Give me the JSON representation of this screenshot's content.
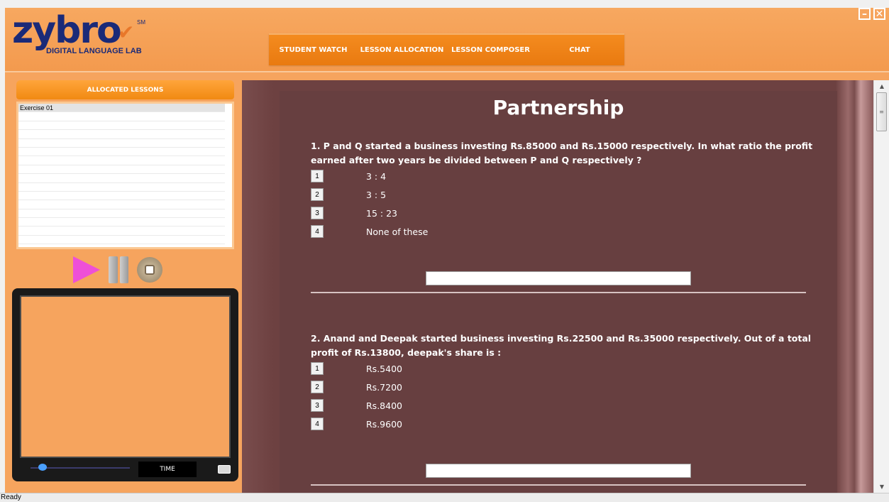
{
  "logo": {
    "wordmark": "zybro",
    "subtitle": "DIGITAL LANGUAGE LAB",
    "mark": "SM"
  },
  "window_controls": {
    "minimize": "–",
    "close": "✕"
  },
  "topnav": [
    "STUDENT WATCH",
    "LESSON ALLOCATION",
    "LESSON COMPOSER",
    "CHAT"
  ],
  "sidebar": {
    "header": "ALLOCATED LESSONS",
    "lessons": [
      "Exercise 01"
    ]
  },
  "player": {
    "time_label": "TIME",
    "progress_fraction": 0.12
  },
  "quiz": {
    "title": "Partnership",
    "questions": [
      {
        "text": "1. P and Q started a business investing Rs.85000 and Rs.15000 respectively. In what ratio the profit earned after two years be divided between P and Q respectively ?",
        "options": [
          {
            "num": "1",
            "text": "3 : 4"
          },
          {
            "num": "2",
            "text": "3 : 5"
          },
          {
            "num": "3",
            "text": "15 : 23"
          },
          {
            "num": "4",
            "text": "None of these"
          }
        ],
        "answer": ""
      },
      {
        "text": "2. Anand and Deepak started business investing Rs.22500 and Rs.35000 respectively. Out of a total profit of Rs.13800, deepak's share is :",
        "options": [
          {
            "num": "1",
            "text": "Rs.5400"
          },
          {
            "num": "2",
            "text": "Rs.7200"
          },
          {
            "num": "3",
            "text": "Rs.8400"
          },
          {
            "num": "4",
            "text": "Rs.9600"
          }
        ],
        "answer": ""
      }
    ]
  },
  "status": {
    "text": "Ready"
  },
  "colors": {
    "background": "#f6a45e",
    "nav": "#f18a12",
    "card": "#673f40",
    "accent_play": "#ee4fd7"
  }
}
